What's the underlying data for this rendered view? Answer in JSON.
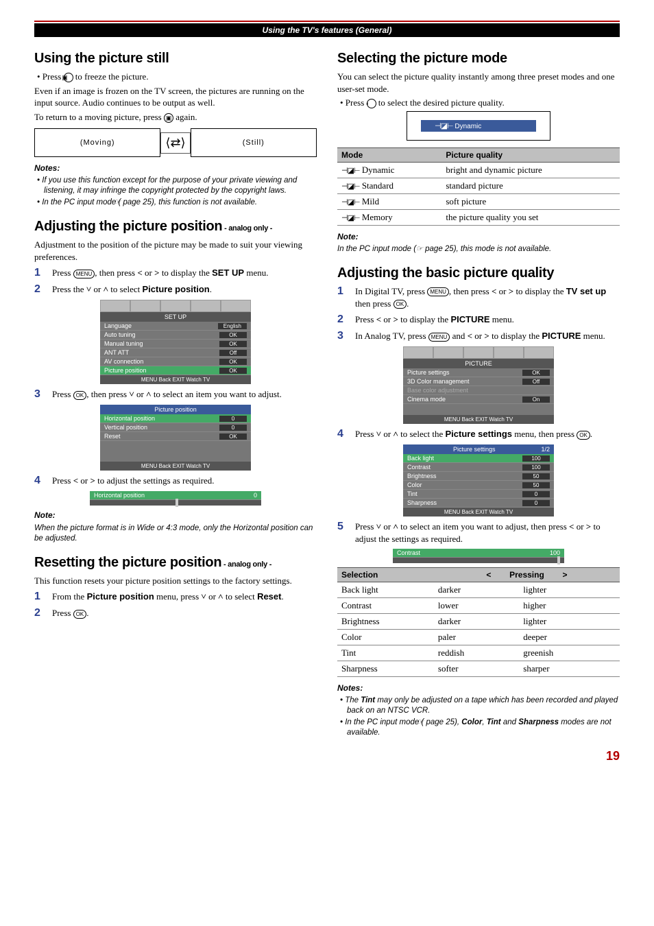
{
  "header": "Using the TV's features (General)",
  "page_number": "19",
  "left": {
    "sec1": {
      "title": "Using the picture still",
      "b1": "• Press",
      "b1b": "to freeze the picture.",
      "p1": "Even if an image is frozen on the TV screen, the pictures are running on the input source. Audio continues to be output as well.",
      "p2a": "To return to a moving picture, press",
      "p2b": "again.",
      "diag_moving": "(Moving)",
      "diag_still": "(Still)",
      "notes_head": "Notes:",
      "n1": "• If you use this function except for the purpose of your private viewing and listening, it may infringe the copyright protected by the copyright laws.",
      "n2a": "• In the PC input mode (",
      "n2b": " page 25), this function is not available."
    },
    "sec2": {
      "title": "Adjusting the picture position",
      "sub": " - analog only -",
      "intro": "Adjustment to the position of the picture may be made to suit your viewing preferences.",
      "s1a": "Press",
      "s1b": ", then press",
      "s1c": "or",
      "s1d": "to display the",
      "s1e": "SET UP",
      "s1f": "menu.",
      "s2a": "Press the",
      "s2b": "or",
      "s2c": "to select",
      "s2d": "Picture position",
      "s2e": ".",
      "osd_title": "SET UP",
      "osd_rows": [
        {
          "l": "Language",
          "v": "English"
        },
        {
          "l": "Auto tuning",
          "v": "OK"
        },
        {
          "l": "Manual tuning",
          "v": "OK"
        },
        {
          "l": "ANT ATT",
          "v": "Off"
        },
        {
          "l": "AV connection",
          "v": "OK"
        },
        {
          "l": "Picture position",
          "v": "OK"
        }
      ],
      "osd_foot": "MENU Back   EXIT Watch TV",
      "s3a": "Press",
      "s3b": ", then press",
      "s3c": "or",
      "s3d": "to select an item you want to adjust.",
      "osd2_title": "Picture position",
      "osd2_rows": [
        {
          "l": "Horizontal position",
          "v": "0"
        },
        {
          "l": "Vertical position",
          "v": "0"
        },
        {
          "l": "Reset",
          "v": "OK"
        }
      ],
      "s4a": "Press",
      "s4b": "or",
      "s4c": "to adjust the settings as required.",
      "strip_l": "Horizontal position",
      "strip_v": "0",
      "note_head": "Note:",
      "note": "When the picture format is in Wide or 4:3 mode, only the Horizontal position can be adjusted."
    },
    "sec3": {
      "title": "Resetting the picture position",
      "sub": " - analog only -",
      "intro": "This function resets your picture position settings to the factory settings.",
      "s1a": "From the",
      "s1b": "Picture position",
      "s1c": "menu, press",
      "s1d": "or",
      "s1e": "to select",
      "s1f": "Reset",
      "s1g": ".",
      "s2a": "Press",
      "s2b": "."
    }
  },
  "right": {
    "sec1": {
      "title": "Selecting the picture mode",
      "intro": "You can select the picture quality instantly among three preset modes and one user-set mode.",
      "b1a": "• Press",
      "b1b": "to select the desired picture quality.",
      "indicator": "Dynamic",
      "th_mode": "Mode",
      "th_quality": "Picture quality",
      "modes": [
        {
          "m": "Dynamic",
          "q": "bright and dynamic picture"
        },
        {
          "m": "Standard",
          "q": "standard picture"
        },
        {
          "m": "Mild",
          "q": "soft picture"
        },
        {
          "m": "Memory",
          "q": "the picture quality you set"
        }
      ],
      "note_head": "Note:",
      "note_a": "In the PC input mode (",
      "note_b": " page 25), this mode is not available."
    },
    "sec2": {
      "title": "Adjusting the basic picture quality",
      "s1a": "In Digital TV, press",
      "s1b": ", then press",
      "s1c": "or",
      "s1d": "to display the",
      "s1e": "TV set up",
      "s1f": "then press",
      "s1g": ".",
      "s2a": "Press",
      "s2b": "or",
      "s2c": "to display the",
      "s2d": "PICTURE",
      "s2e": "menu.",
      "s3a": "In Analog TV, press",
      "s3b": "and",
      "s3c": "or",
      "s3d": "to display the",
      "s3e": "PICTURE",
      "s3f": "menu.",
      "osd_title": "PICTURE",
      "osd_rows": [
        {
          "l": "Picture settings",
          "v": "OK"
        },
        {
          "l": "3D Color management",
          "v": "Off"
        },
        {
          "l": "Base color adjustment",
          "v": ""
        },
        {
          "l": "Cinema mode",
          "v": "On"
        }
      ],
      "osd_foot": "MENU Back   EXIT Watch TV",
      "s4a": "Press",
      "s4b": "or",
      "s4c": "to select the",
      "s4d": "Picture settings",
      "s4e": "menu, then press",
      "s4f": ".",
      "osd2_title": "Picture settings",
      "osd2_page": "1/2",
      "osd2_rows": [
        {
          "l": "Back light",
          "v": "100"
        },
        {
          "l": "Contrast",
          "v": "100"
        },
        {
          "l": "Brightness",
          "v": "50"
        },
        {
          "l": "Color",
          "v": "50"
        },
        {
          "l": "Tint",
          "v": "0"
        },
        {
          "l": "Sharpness",
          "v": "0"
        }
      ],
      "s5a": "Press",
      "s5b": "or",
      "s5c": "to select an item you want to adjust, then press",
      "s5d": "or",
      "s5e": "to adjust the settings as required.",
      "strip_l": "Contrast",
      "strip_v": "100",
      "th_sel": "Selection",
      "th_press": "Pressing",
      "selections": [
        {
          "s": "Back light",
          "l": "darker",
          "r": "lighter"
        },
        {
          "s": "Contrast",
          "l": "lower",
          "r": "higher"
        },
        {
          "s": "Brightness",
          "l": "darker",
          "r": "lighter"
        },
        {
          "s": "Color",
          "l": "paler",
          "r": "deeper"
        },
        {
          "s": "Tint",
          "l": "reddish",
          "r": "greenish"
        },
        {
          "s": "Sharpness",
          "l": "softer",
          "r": "sharper"
        }
      ],
      "notes_head": "Notes:",
      "n1a": "• The",
      "n1b": "Tint",
      "n1c": "may only be adjusted on a tape which has been recorded and played back on an NTSC VCR.",
      "n2a": "• In the PC input mode (",
      "n2b": " page 25),",
      "n2c": "Color",
      "n2d": ",",
      "n2e": "Tint",
      "n2f": "and",
      "n2g": "Sharpness",
      "n2h": "modes are not available."
    }
  }
}
